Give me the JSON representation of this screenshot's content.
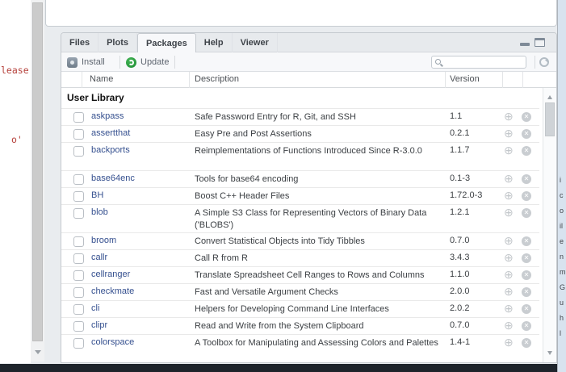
{
  "window": {
    "console_fragment": {
      "lines": [
        {
          "text": "lease"
        },
        {
          "text": "o'"
        }
      ]
    },
    "background_window_fragments": [
      "i",
      "c",
      "o",
      "il",
      "e",
      "n",
      "m",
      "G",
      "u",
      "h",
      "l"
    ]
  },
  "pane": {
    "tabs": [
      {
        "label": "Files"
      },
      {
        "label": "Plots"
      },
      {
        "label": "Packages",
        "selected": true
      },
      {
        "label": "Help"
      },
      {
        "label": "Viewer"
      }
    ],
    "toolbar": {
      "install_label": "Install",
      "update_label": "Update",
      "search_value": "",
      "search_placeholder": ""
    },
    "table": {
      "columns": {
        "name": "Name",
        "description": "Description",
        "version": "Version"
      },
      "group_header": "User Library",
      "packages": [
        {
          "name": "askpass",
          "description": "Safe Password Entry for R, Git, and SSH",
          "version": "1.1"
        },
        {
          "name": "assertthat",
          "description": "Easy Pre and Post Assertions",
          "version": "0.2.1"
        },
        {
          "name": "backports",
          "description": "Reimplementations of Functions Introduced Since R-3.0.0",
          "version": "1.1.7"
        },
        {
          "name": "base64enc",
          "description": "Tools for base64 encoding",
          "version": "0.1-3"
        },
        {
          "name": "BH",
          "description": "Boost C++ Header Files",
          "version": "1.72.0-3"
        },
        {
          "name": "blob",
          "description": "A Simple S3 Class for Representing Vectors of Binary Data ('BLOBS')",
          "version": "1.2.1"
        },
        {
          "name": "broom",
          "description": "Convert Statistical Objects into Tidy Tibbles",
          "version": "0.7.0"
        },
        {
          "name": "callr",
          "description": "Call R from R",
          "version": "3.4.3"
        },
        {
          "name": "cellranger",
          "description": "Translate Spreadsheet Cell Ranges to Rows and Columns",
          "version": "1.1.0"
        },
        {
          "name": "checkmate",
          "description": "Fast and Versatile Argument Checks",
          "version": "2.0.0"
        },
        {
          "name": "cli",
          "description": "Helpers for Developing Command Line Interfaces",
          "version": "2.0.2"
        },
        {
          "name": "clipr",
          "description": "Read and Write from the System Clipboard",
          "version": "0.7.0"
        },
        {
          "name": "colorspace",
          "description": "A Toolbox for Manipulating and Assessing Colors and Palettes",
          "version": "1.4-1"
        }
      ]
    }
  },
  "colors": {
    "link_blue": "#35508f",
    "update_green": "#2e9e3f",
    "console_red": "#b5403a",
    "bottom_bar_dark": "#1e242b",
    "tab_bar_bg": "#e7eaed",
    "toolbar_bg": "#f7f8fa"
  }
}
